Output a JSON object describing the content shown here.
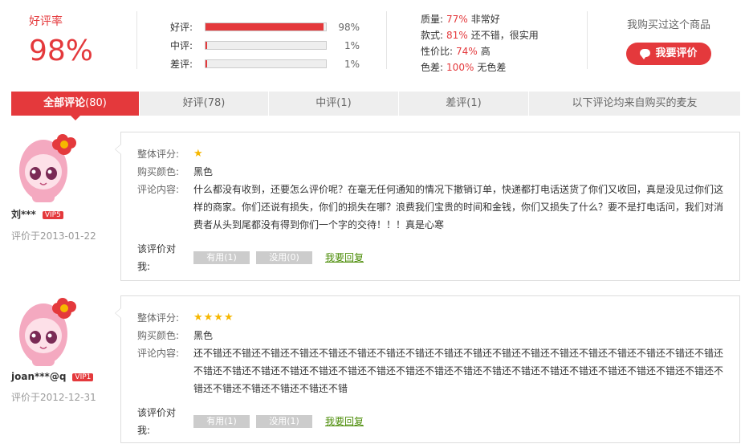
{
  "summary": {
    "rate_label": "好评率",
    "rate_value": "98%",
    "bars": [
      {
        "label": "好评:",
        "percent": "98%",
        "fill": 0.98
      },
      {
        "label": "中评:",
        "percent": "1%",
        "fill": 0.01
      },
      {
        "label": "差评:",
        "percent": "1%",
        "fill": 0.01
      }
    ],
    "attributes": [
      {
        "label": "质量:",
        "pct": "77%",
        "desc": "非常好"
      },
      {
        "label": "款式:",
        "pct": "81%",
        "desc": "还不错，很实用"
      },
      {
        "label": "性价比:",
        "pct": "74%",
        "desc": "高"
      },
      {
        "label": "色差:",
        "pct": "100%",
        "desc": "无色差"
      }
    ],
    "bought_text": "我购买过这个商品",
    "review_button": "我要评价"
  },
  "tabs": [
    {
      "label": "全部评论",
      "count": "(80)"
    },
    {
      "label": "好评",
      "count": "(78)"
    },
    {
      "label": "中评",
      "count": "(1)"
    },
    {
      "label": "差评",
      "count": "(1)"
    },
    {
      "label": "以下评论均来自购买的麦友",
      "count": ""
    }
  ],
  "labels": {
    "overall": "整体评分:",
    "color": "购买颜色:",
    "content": "评论内容:",
    "vote_prompt": "该评价对我:",
    "useful": "有用",
    "useless": "没用",
    "reply": "我要回复"
  },
  "reviews": [
    {
      "user": "刘***",
      "vip": "VIP5",
      "date": "评价于2013-01-22",
      "stars": "★",
      "color": "黑色",
      "content": "什么都没有收到，还要怎么评价呢？在毫无任何通知的情况下撤销订单，快递都打电话送货了你们又收回，真是没见过你们这样的商家。你们还说有损失，你们的损失在哪？浪费我们宝贵的时间和金钱，你们又损失了什么？要不是打电话问，我们对消费者从头到尾都没有得到你们一个字的交待！！！真是心寒",
      "useful_count": "(1)",
      "useless_count": "(0)"
    },
    {
      "user": "joan***@q",
      "vip": "VIP1",
      "date": "评价于2012-12-31",
      "stars": "★★★★",
      "color": "黑色",
      "content": "还不错还不错还不错还不错还不错还不错还不错还不错还不错还不错还不错还不错还不错还不错还不错还不错还不错还不错还不错还不错还不错还不错还不错还不错还不错还不错还不错还不错还不错还不错还不错还不错还不错还不错还不错还不错还不错还不错还不错还不错还不错还不错",
      "useful_count": "(1)",
      "useless_count": "(1)"
    }
  ],
  "colors": {
    "accent": "#e4393c",
    "star": "#f6b700",
    "link": "#4b8c07"
  }
}
